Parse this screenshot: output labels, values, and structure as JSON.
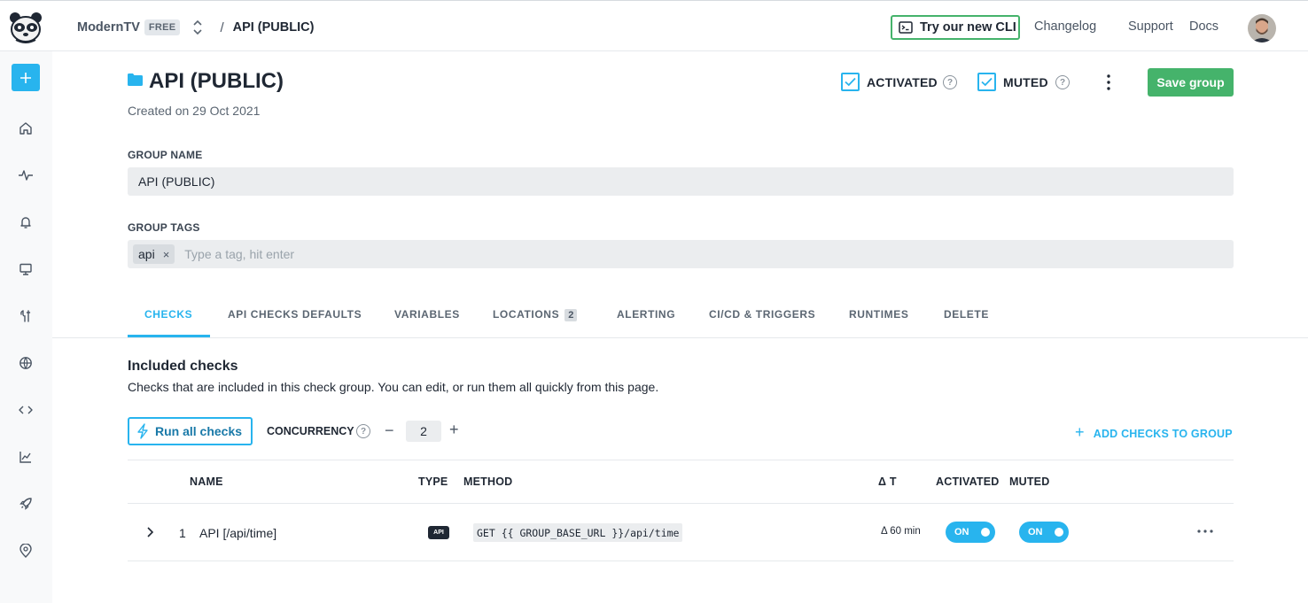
{
  "topbar": {
    "account_name": "ModernTV",
    "plan_badge": "FREE",
    "separator": "/",
    "current_crumb": "API (PUBLIC)",
    "cli_button": "Try our new CLI",
    "links": [
      "Changelog",
      "Support",
      "Docs"
    ]
  },
  "page": {
    "title": "API (PUBLIC)",
    "created": "Created on 29 Oct 2021",
    "activated_label": "ACTIVATED",
    "muted_label": "MUTED",
    "save_button": "Save group"
  },
  "form": {
    "group_name_label": "GROUP NAME",
    "group_name_value": "API (PUBLIC)",
    "group_tags_label": "GROUP TAGS",
    "tags": [
      "api"
    ],
    "tag_remove": "×",
    "tag_placeholder": "Type a tag, hit enter"
  },
  "tabs": [
    {
      "label": "CHECKS"
    },
    {
      "label": "API CHECKS DEFAULTS"
    },
    {
      "label": "VARIABLES"
    },
    {
      "label": "LOCATIONS",
      "count": "2"
    },
    {
      "label": "ALERTING"
    },
    {
      "label": "CI/CD & TRIGGERS"
    },
    {
      "label": "RUNTIMES"
    },
    {
      "label": "DELETE"
    }
  ],
  "checks_section": {
    "title": "Included checks",
    "description": "Checks that are included in this check group. You can edit, or run them all quickly from this page.",
    "run_all_button": "Run all checks",
    "concurrency_label": "CONCURRENCY",
    "concurrency_minus": "−",
    "concurrency_value": "2",
    "concurrency_plus": "+",
    "add_checks_plus": "+",
    "add_checks_label": "ADD CHECKS TO GROUP"
  },
  "table": {
    "headers": {
      "name": "NAME",
      "type": "TYPE",
      "method": "METHOD",
      "delta": "Δ T",
      "activated": "ACTIVATED",
      "muted": "MUTED"
    },
    "rows": [
      {
        "index": "1",
        "name": "API [/api/time]",
        "type_badge": "API",
        "method": "GET {{ GROUP_BASE_URL }}/api/time",
        "delta": "Δ 60 min",
        "activated": "ON",
        "muted": "ON"
      }
    ]
  },
  "sidebar": {
    "icons": [
      "home-icon",
      "activity-icon",
      "bell-icon",
      "monitor-icon",
      "tools-icon",
      "globe-icon",
      "code-icon",
      "chart-icon",
      "rocket-icon",
      "location-pin-icon"
    ]
  },
  "colors": {
    "accent": "#28b4ee",
    "success": "#45b36b",
    "text": "#1f2733",
    "field_bg": "#ebedef"
  }
}
